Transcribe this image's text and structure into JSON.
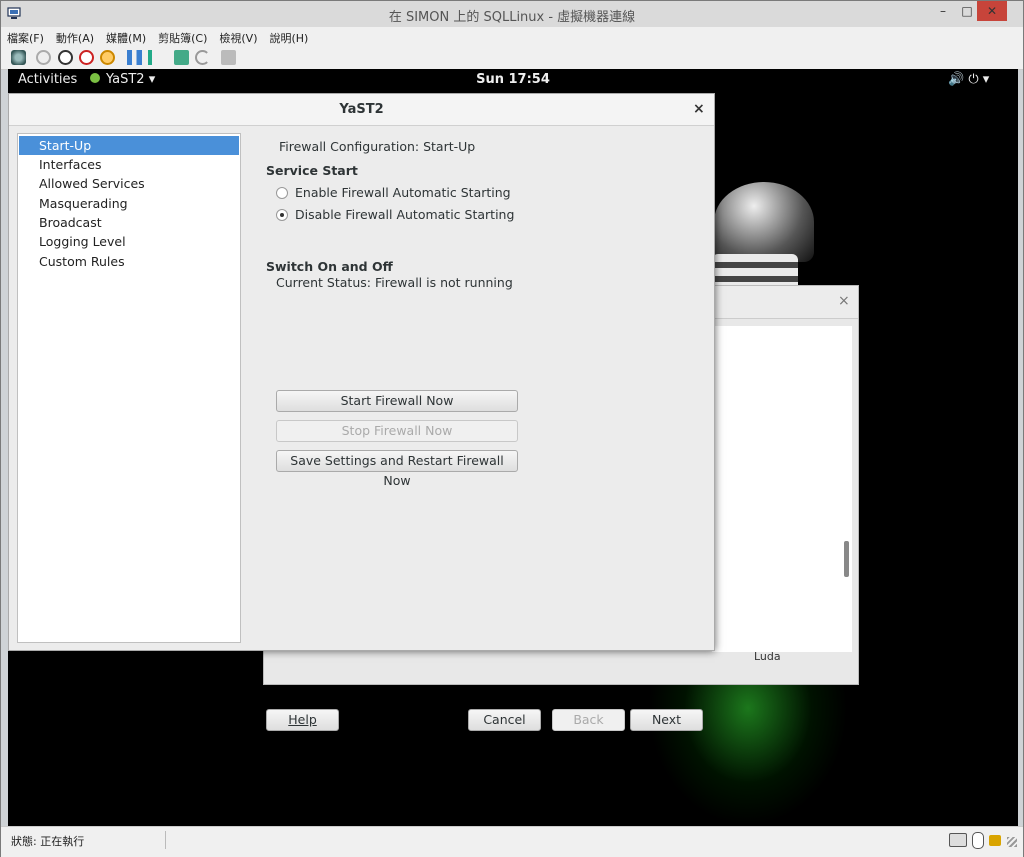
{
  "window": {
    "title": "在 SIMON 上的 SQLLinux - 虛擬機器連線",
    "minimize": "–",
    "maximize": "□",
    "close": "✕"
  },
  "menubar": {
    "items": [
      "檔案(F)",
      "動作(A)",
      "媒體(M)",
      "剪貼簿(C)",
      "檢視(V)",
      "說明(H)"
    ]
  },
  "toolbar": {
    "icons": [
      "ctrl-alt-del-icon",
      "start-icon",
      "turn-off-icon",
      "shutdown-icon",
      "save-icon",
      "pause-icon",
      "reset-icon",
      "checkpoint-icon",
      "revert-icon",
      "enhanced-session-icon"
    ]
  },
  "gnome": {
    "activities": "Activities",
    "app_name": "YaST2 ▾",
    "clock": "Sun 17:54",
    "system_menu": "🔊  ⏻  ▾"
  },
  "background_window": {
    "close": "×",
    "partial_label": "Luda"
  },
  "yast": {
    "title": "YaST2",
    "close": "×",
    "sidebar": [
      "Start-Up",
      "Interfaces",
      "Allowed Services",
      "Masquerading",
      "Broadcast",
      "Logging Level",
      "Custom Rules"
    ],
    "selected_index": 0,
    "heading": "Firewall Configuration: Start-Up",
    "service_start": {
      "title": "Service Start",
      "options": [
        "Enable Firewall Automatic Starting",
        "Disable Firewall Automatic Starting"
      ],
      "selected": 1
    },
    "switch": {
      "title": "Switch On and Off",
      "status_label": "Current Status:",
      "status_value": "Firewall is not running",
      "start": "Start Firewall Now",
      "stop": "Stop Firewall Now",
      "save_restart": "Save Settings and Restart Firewall Now"
    },
    "buttons": {
      "help": "Help",
      "cancel": "Cancel",
      "back": "Back",
      "next": "Next"
    }
  },
  "status": {
    "text": "狀態: 正在執行"
  }
}
